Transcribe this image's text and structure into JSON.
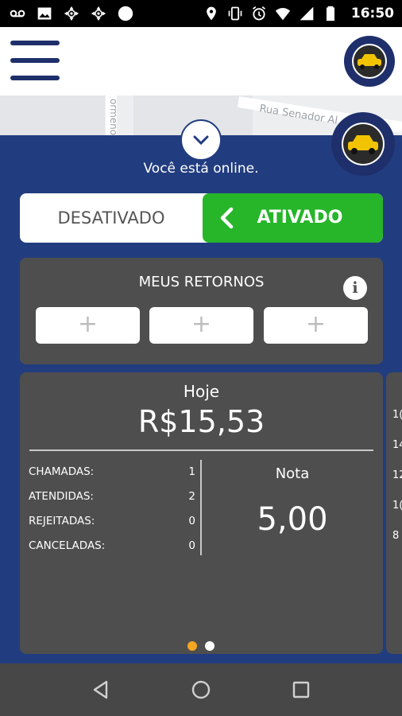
{
  "status_bar": {
    "time": "16:50",
    "left_icons": [
      "voicemail-icon",
      "image-icon",
      "gps-icon",
      "gps-icon",
      "circle-icon"
    ],
    "right_icons": [
      "location-icon",
      "vibrate-icon",
      "alarm-icon",
      "wifi-icon",
      "signal-icon",
      "battery-icon"
    ]
  },
  "app_bar": {
    "menu_icon": "hamburger-menu-icon",
    "logo": "app-logo-taxi"
  },
  "map": {
    "street_label": "Rua Senador Al",
    "street_label_vertical": "ormeno G"
  },
  "status": {
    "online_text": "Você está online."
  },
  "toggle": {
    "off_label": "DESATIVADO",
    "on_label": "ATIVADO",
    "active_color": "#27b52a"
  },
  "retornos": {
    "title": "MEUS RETORNOS",
    "info_icon": "i",
    "slots": [
      "+",
      "+",
      "+"
    ]
  },
  "stats": {
    "period": "Hoje",
    "total": "R$15,53",
    "rows": [
      {
        "label": "CHAMADAS:",
        "value": "1"
      },
      {
        "label": "ATENDIDAS:",
        "value": "2"
      },
      {
        "label": "REJEITADAS:",
        "value": "0"
      },
      {
        "label": "CANCELADAS:",
        "value": "0"
      }
    ],
    "rating_label": "Nota",
    "rating_value": "5,00"
  },
  "pager": {
    "active_color": "#f5a623",
    "inactive_color": "#ffffff",
    "pages": 2,
    "current": 1
  },
  "peek_card": {
    "values": [
      "1(",
      "14",
      "12",
      "1(",
      "8"
    ]
  },
  "colors": {
    "panel": "#223d7f",
    "card": "#4e4e4e",
    "brand_navy": "#1e2f6b"
  }
}
